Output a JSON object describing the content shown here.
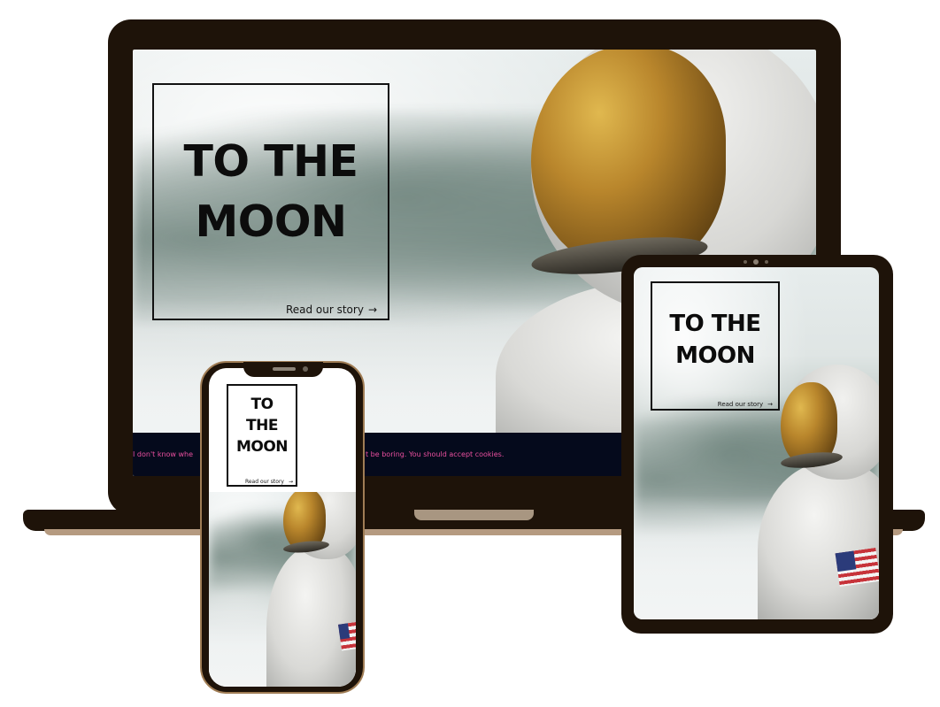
{
  "laptop": {
    "hero": {
      "title_line1": "TO THE",
      "title_line2": "MOON",
      "link_label": "Read our story",
      "link_icon": "arrow-right-icon"
    },
    "cookie_banner": {
      "text_left": "I don't know whe",
      "text_right": "t be boring. You should accept cookies."
    }
  },
  "tablet": {
    "hero": {
      "title_line1": "TO THE",
      "title_line2": "MOON",
      "link_label": "Read our story",
      "link_icon": "arrow-right-icon"
    }
  },
  "phone": {
    "hero": {
      "title_line1": "TO",
      "title_line2": "THE",
      "title_line3": "MOON",
      "link_label": "Read our story",
      "link_icon": "arrow-right-icon"
    }
  },
  "colors": {
    "device_frame": "#1e1309",
    "cookie_bg": "#050a1c",
    "cookie_text": "#ea4f9f",
    "visor_gold": "#b9862c"
  }
}
